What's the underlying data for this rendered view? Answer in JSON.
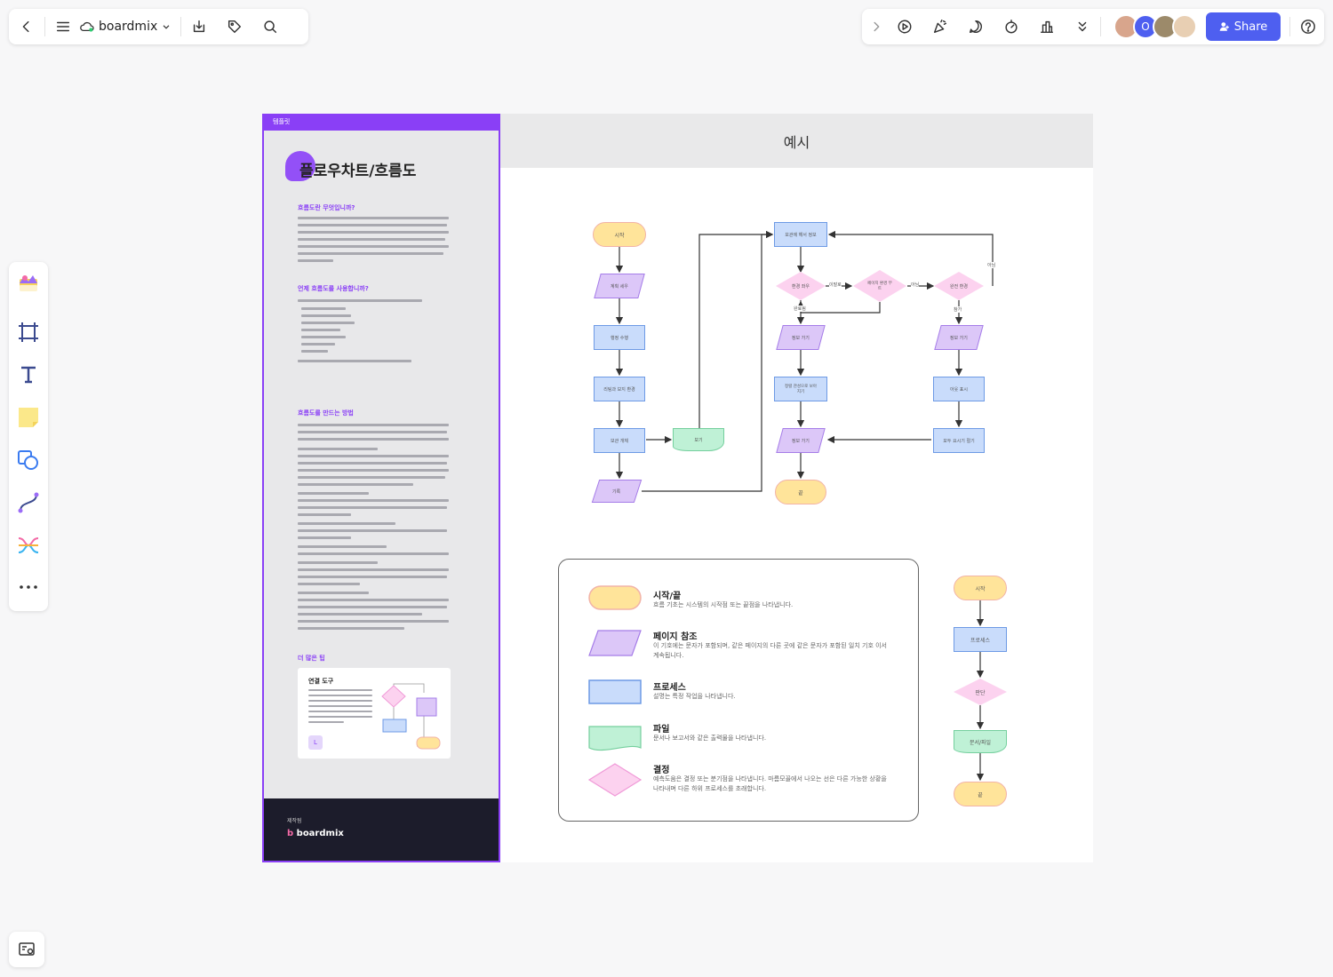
{
  "toolbar": {
    "brand": "boardmix",
    "share_label": "Share"
  },
  "template": {
    "tag": "템플릿",
    "title": "플로우차트/흐름도",
    "section1_heading": "흐름도란 무엇입니까?",
    "section2_heading": "언제 흐름도를 사용합니까?",
    "section3_heading": "흐름도를 만드는 방법",
    "section4_heading": "더 많은 팁",
    "tip_card_title": "연결 도구",
    "tip_card_badge": "L",
    "footer_small": "제작됨",
    "footer_logo": "boardmix"
  },
  "example": {
    "header": "예시"
  },
  "flow": {
    "start": "시작",
    "n_input1": "계획 세우",
    "n_proc1": "행정 수행",
    "n_proc2": "리팅과 보지 환경",
    "n_proc3": "보관 개체",
    "n_file": "보기",
    "n_input2": "기록",
    "n_proc_top": "보관에 해서 정보",
    "d1": "환경 좌우",
    "d1_yes": "이말로",
    "d2": "페이지 환경 부트",
    "d2_no": "아님",
    "d3": "완전 환경",
    "d3_no": "아님",
    "d3_yes": "참가",
    "d1_below": "완료됨",
    "c1_in": "정보 가기",
    "c1_proc": "정렬 관성으로 보아지기",
    "c1_in2": "정보 가기",
    "end": "끝",
    "c2_in": "정보 가기",
    "c2_proc": "아웃 표시",
    "c2_proc2": "모두 요시기 절기"
  },
  "legend": [
    {
      "title": "시작/끝",
      "desc": "흐름 기초는 시스템의 시작점 또는 끝점을 나타냅니다."
    },
    {
      "title": "페이지 참조",
      "desc": "이 기호에는 문자가 포함되며, 같은 페이지의 다른 곳에 같은 문자가 포함된 일치 기호 이서 계속됩니다."
    },
    {
      "title": "프로세스",
      "desc": "설명는 특정 작업을 나타냅니다."
    },
    {
      "title": "파일",
      "desc": "문서나 보고서와 같은 출력물을 나타냅니다."
    },
    {
      "title": "결정",
      "desc": "예측도움은 결정 또는 분기점을 나타냅니다. 마름모꼴에서 나오는 선은 다른 가능한 상황을 나타내며 다른 하위 프로세스를 초래합니다."
    }
  ],
  "mini_flow": {
    "start": "시작",
    "proc": "프로세스",
    "decision": "판단",
    "file": "문서/파일",
    "end": "끝"
  },
  "colors": {
    "accent": "#8a3ff6",
    "share": "#4e5ff0",
    "terminal_fill": "#ffe49a",
    "terminal_stroke": "#f2b3a7",
    "io_fill": "#dcc7f8",
    "io_stroke": "#a57ce8",
    "process_fill": "#c9dcfb",
    "process_stroke": "#6d9ae5",
    "file_fill": "#bff1d6",
    "file_stroke": "#74cf9d",
    "decision_fill": "#fcd2ef",
    "decision_stroke": "#f09ad8"
  },
  "icons": [
    "back-icon",
    "menu-icon",
    "cloud-icon",
    "chevron-down-icon",
    "download-icon",
    "tag-icon",
    "search-icon",
    "chevron-right-icon",
    "play-icon",
    "celebrate-icon",
    "comment-icon",
    "timer-icon",
    "vote-icon",
    "more-down-icon",
    "user-icon",
    "help-icon",
    "template-icon",
    "frame-icon",
    "text-icon",
    "sticky-note-icon",
    "shape-icon",
    "connector-icon",
    "mindmap-icon",
    "more-icon",
    "minimap-icon"
  ]
}
